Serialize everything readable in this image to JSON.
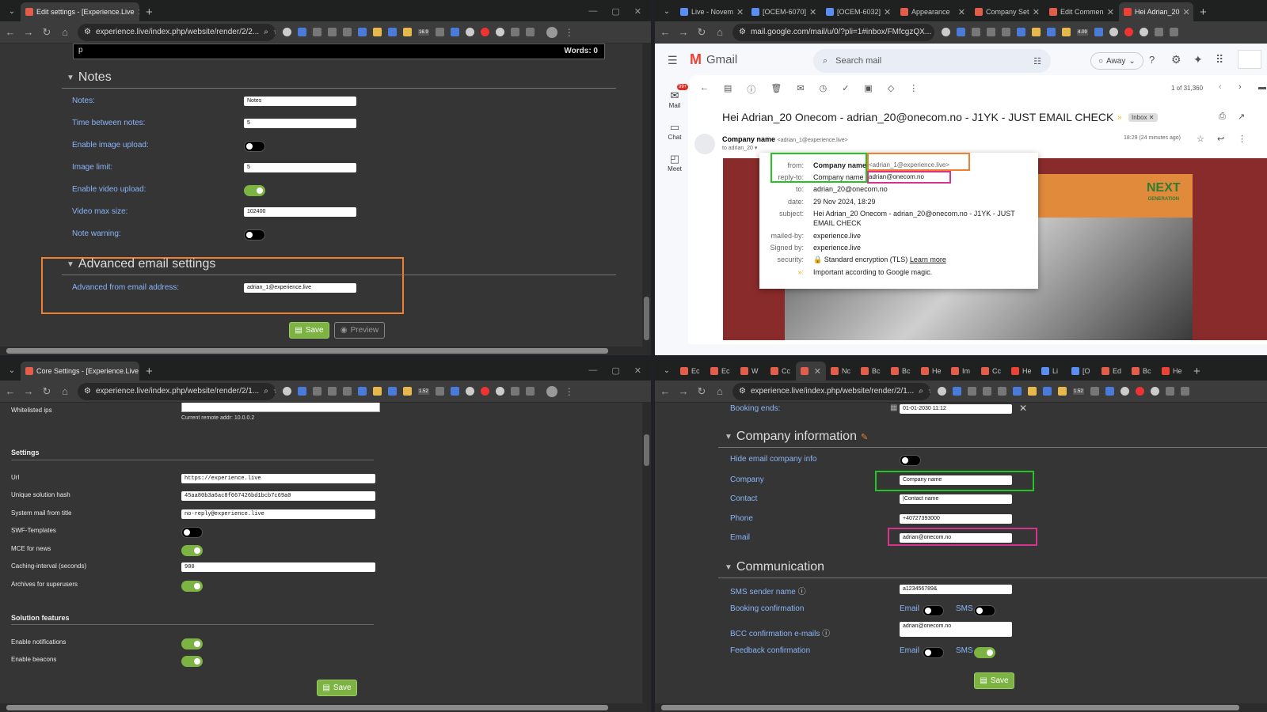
{
  "q1": {
    "tab_title": "Edit settings - [Experience.Live",
    "url": "experience.live/index.php/website/render/2/2...",
    "ext_badge": "16.9",
    "editor_text": "p",
    "words": "Words: 0",
    "notes_header": "Notes",
    "rows": [
      {
        "label": "Notes:",
        "value": "Notes"
      },
      {
        "label": "Time between notes:",
        "value": "5"
      },
      {
        "label": "Enable image upload:"
      },
      {
        "label": "Image limit:",
        "value": "5"
      },
      {
        "label": "Enable video upload:"
      },
      {
        "label": "Video max size:",
        "value": "102400"
      },
      {
        "label": "Note warning:"
      }
    ],
    "adv_header": "Advanced email settings",
    "adv_label": "Advanced from email address:",
    "adv_value": "adrian_1@experience.live",
    "save": "Save",
    "preview": "Preview"
  },
  "q2": {
    "tabs": [
      "Live - Novem",
      "[OCEM-6070]",
      "[OCEM-6032]",
      "Appearance",
      "Company Set",
      "Edit Commen",
      "Hei Adrian_20"
    ],
    "url": "mail.google.com/mail/u/0/?pli=1#inbox/FMfcgzQX...",
    "ext_badge": "4.09",
    "app_name": "Gmail",
    "search_placeholder": "Search mail",
    "status": "Away",
    "rail": [
      "Mail",
      "Chat",
      "Meet"
    ],
    "mail_badge": "99+",
    "pager": "1 of 31,360",
    "subject": "Hei Adrian_20 Onecom - adrian_20@onecom.no - J1YK - JUST EMAIL CHECK",
    "inbox_label": "Inbox",
    "sender_name": "Company name",
    "sender_email": "<adrian_1@experience.live>",
    "to_line": "to adrian_20",
    "time": "18:29 (24 minutes ago)",
    "details": [
      {
        "k": "from:",
        "v": "Company name",
        "v2": "<adrian_1@experience.live>"
      },
      {
        "k": "reply-to:",
        "v": "Company name",
        "v2": "adrian@onecom.no"
      },
      {
        "k": "to:",
        "v": "adrian_20@onecom.no"
      },
      {
        "k": "date:",
        "v": "29 Nov 2024, 18:29"
      },
      {
        "k": "subject:",
        "v": "Hei Adrian_20 Onecom - adrian_20@onecom.no - J1YK - JUST",
        "v2": "EMAIL CHECK"
      },
      {
        "k": "mailed-by:",
        "v": "experience.live"
      },
      {
        "k": "Signed by:",
        "v": "experience.live"
      },
      {
        "k": "security:",
        "v": "Standard encryption (TLS)",
        "v2": "Learn more"
      },
      {
        "k": "",
        "v": "Important according to Google magic."
      }
    ],
    "banner": "NEXT",
    "banner_sub": "GENERATION"
  },
  "q3": {
    "tab_title": "Core Settings - [Experience.Live",
    "url": "experience.live/index.php/website/render/2/1...",
    "ext_badge": "1.52",
    "whitelist_label": "Whitelisted ips",
    "remote_addr": "Current remote addr: 10.0.0.2",
    "settings_header": "Settings",
    "rows": [
      {
        "label": "Url",
        "value": "https://experience.live"
      },
      {
        "label": "Unique solution hash",
        "value": "45aa80b3a6ac8f667426bd1bcb7c69a0"
      },
      {
        "label": "System mail from title",
        "value": "no-reply@experience.live"
      },
      {
        "label": "SWF-Templates"
      },
      {
        "label": "MCE for news"
      },
      {
        "label": "Caching-interval (seconds)",
        "value": "900"
      },
      {
        "label": "Archives for superusers"
      }
    ],
    "features_header": "Solution features",
    "features": [
      {
        "label": "Enable notifications"
      },
      {
        "label": "Enable beacons"
      }
    ],
    "save": "Save"
  },
  "q4": {
    "tabs": [
      "Ec",
      "Ec",
      "W",
      "Cc",
      "",
      "Nc",
      "Bc",
      "Bc",
      "He",
      "Im",
      "Cc",
      "He",
      "Li",
      "[O",
      "Ed",
      "Bc",
      "He"
    ],
    "url": "experience.live/index.php/website/render/2/1...",
    "ext_badge": "1.52",
    "booking_ends_label": "Booking ends:",
    "booking_ends_value": "01-01-2030 11:12",
    "company_header": "Company information",
    "hide_label": "Hide email company info",
    "company_rows": [
      {
        "label": "Company",
        "value": "Company name"
      },
      {
        "label": "Contact",
        "value": "|Contact name"
      },
      {
        "label": "Phone",
        "value": "+40727393000"
      },
      {
        "label": "Email",
        "value": "adrian@onecom.no"
      }
    ],
    "comm_header": "Communication",
    "sms_sender_label": "SMS sender name",
    "sms_sender_value": "a123456789&",
    "booking_conf_label": "Booking confirmation",
    "bcc_label": "BCC confirmation e-mails",
    "bcc_value": "adrian@onecom.no",
    "feedback_label": "Feedback confirmation",
    "email_word": "Email",
    "sms_word": "SMS",
    "save": "Save"
  }
}
